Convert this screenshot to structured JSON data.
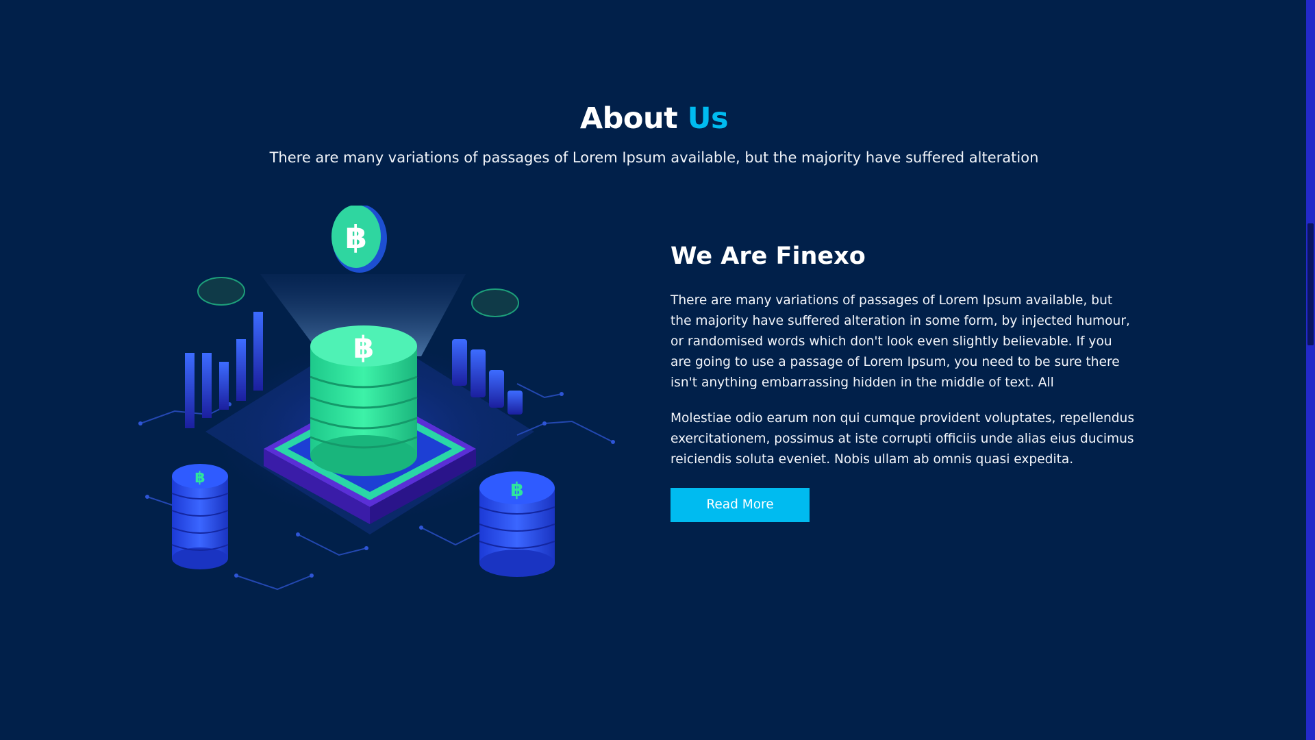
{
  "section": {
    "title_main": "About",
    "title_accent": "Us",
    "subtitle": "There are many variations of passages of Lorem Ipsum available, but the majority have suffered alteration"
  },
  "about": {
    "heading": "We Are Finexo",
    "paragraph_1": "There are many variations of passages of Lorem Ipsum available, but the majority have suffered alteration in some form, by injected humour, or randomised words which don't look even slightly believable. If you are going to use a passage of Lorem Ipsum, you need to be sure there isn't anything embarrassing hidden in the middle of text. All",
    "paragraph_2": "Molestiae odio earum non qui cumque provident voluptates, repellendus exercitationem, possimus at iste corrupti officiis unde alias eius ducimus reiciendis soluta eveniet. Nobis ullam ab omnis quasi expedita.",
    "button_label": "Read More"
  },
  "illustration": {
    "icon": "crypto-coin-stack-icon",
    "symbol": "฿"
  },
  "colors": {
    "background": "#01204a",
    "accent": "#00bbf0",
    "coin_green": "#2ee59d",
    "chart_blue": "#2a4bff",
    "scrollbar": "#2329c9"
  }
}
